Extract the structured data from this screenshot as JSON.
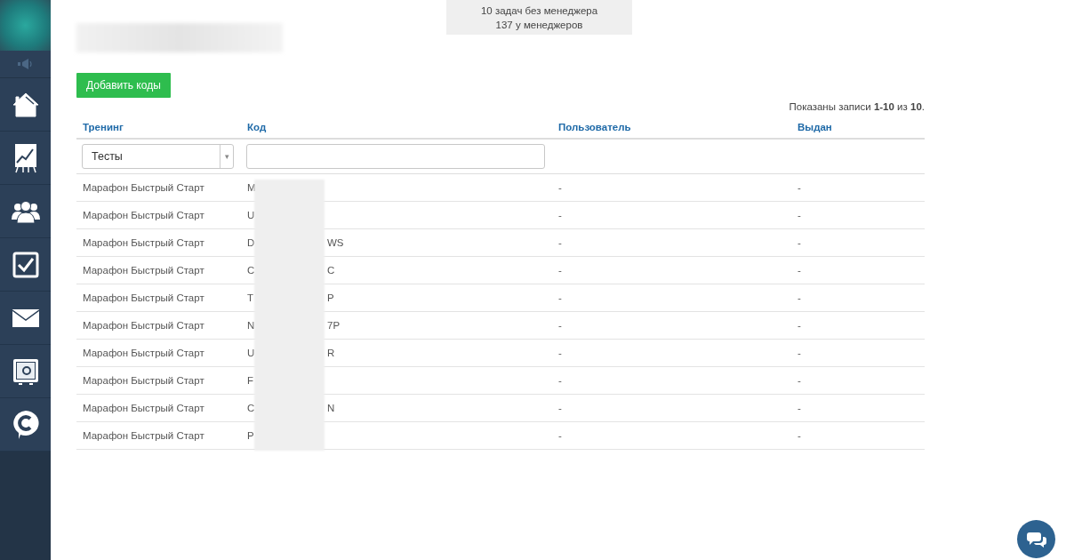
{
  "sidebar": {
    "items": [
      {
        "kind": "home"
      },
      {
        "kind": "chart"
      },
      {
        "kind": "people"
      },
      {
        "kind": "tasks"
      },
      {
        "kind": "mail"
      },
      {
        "kind": "safe"
      },
      {
        "kind": "chat"
      }
    ]
  },
  "notice": {
    "lines": [
      "10 задач без менеджера",
      "137 у менеджеров"
    ]
  },
  "add_button": "Добавить коды",
  "summary": "Показаны записи **1-10** из **10**.",
  "table": {
    "columns": [
      "Тренинг",
      "Код",
      "Пользователь",
      "Выдан"
    ],
    "filter": {
      "select_value": "Тесты",
      "caret": "▾"
    },
    "rows": [
      {
        "training": "Марафон Быстрый Старт",
        "code_start": "M",
        "user": "-",
        "issued": "-"
      },
      {
        "training": "Марафон Быстрый Старт",
        "code_start": "U",
        "user": "-",
        "issued": "-"
      },
      {
        "training": "Марафон Быстрый Старт",
        "code_start": "D",
        "code_end": "WS",
        "user": "-",
        "issued": "-"
      },
      {
        "training": "Марафон Быстрый Старт",
        "code_start": "C",
        "code_end": "C",
        "user": "-",
        "issued": "-"
      },
      {
        "training": "Марафон Быстрый Старт",
        "code_start": "T",
        "code_end": "P",
        "user": "-",
        "issued": "-"
      },
      {
        "training": "Марафон Быстрый Старт",
        "code_start": "N",
        "code_end": "7P",
        "user": "-",
        "issued": "-"
      },
      {
        "training": "Марафон Быстрый Старт",
        "code_start": "U",
        "code_end": "R",
        "user": "-",
        "issued": "-"
      },
      {
        "training": "Марафон Быстрый Старт",
        "code_start": "F",
        "user": "-",
        "issued": "-"
      },
      {
        "training": "Марафон Быстрый Старт",
        "code_start": "C",
        "code_end": "N",
        "user": "-",
        "issued": "-"
      },
      {
        "training": "Марафон Быстрый Старт",
        "code_start": "P",
        "user": "-",
        "issued": "-"
      }
    ]
  }
}
